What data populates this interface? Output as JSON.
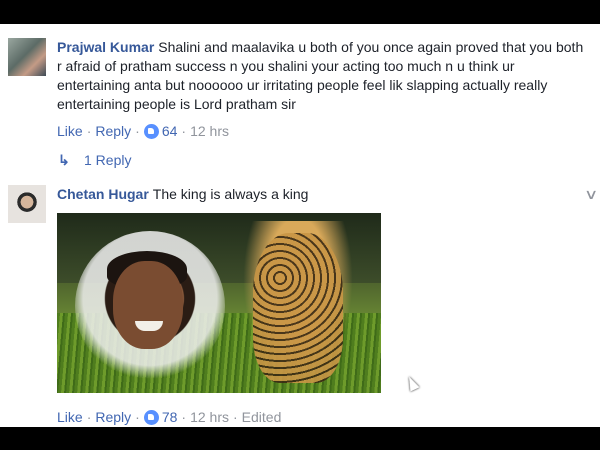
{
  "comments": [
    {
      "author": "Prajwal Kumar",
      "text": "Shalini and maalavika u both of you once again proved that you both r afraid of pratham success n you shalini your acting too much n u think ur entertaining anta but noooooo ur irritating people feel lik slapping actually really entertaining people is Lord pratham sir",
      "like_label": "Like",
      "reply_label": "Reply",
      "reaction_count": "64",
      "time": "12 hrs",
      "replies_label": "1 Reply"
    },
    {
      "author": "Chetan Hugar",
      "text": "The king is always a king",
      "like_label": "Like",
      "reply_label": "Reply",
      "reaction_count": "78",
      "time": "12 hrs",
      "edited_label": "Edited"
    }
  ],
  "icons": {
    "reply_arrow": "reply-arrow-icon",
    "chevron": "chevron-down-icon",
    "reaction": "like-reaction-icon"
  },
  "colors": {
    "author": "#365899",
    "link": "#4267b2",
    "meta": "#90949c",
    "text": "#1d2129"
  }
}
